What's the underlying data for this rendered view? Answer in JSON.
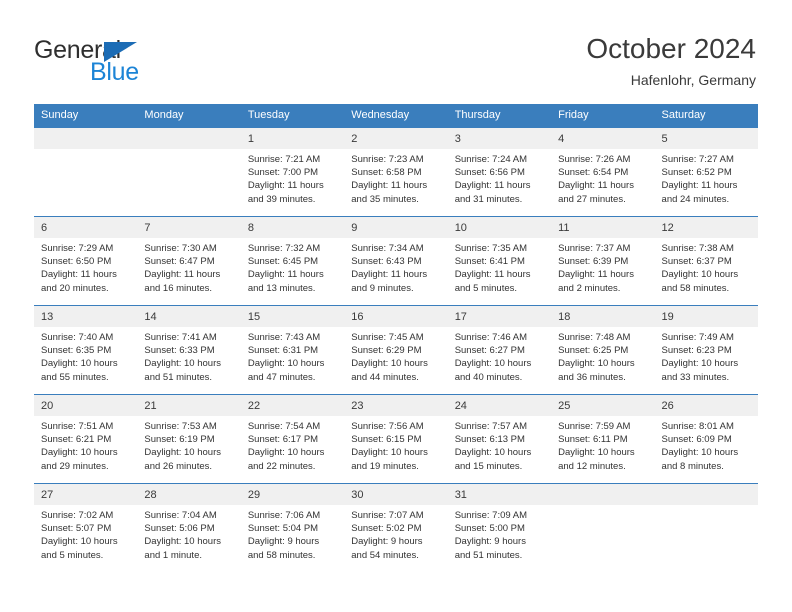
{
  "brand": {
    "name_part1": "General",
    "name_part2": "Blue",
    "triangle_icon": "triangle-icon",
    "color_dark": "#2f2f2f",
    "color_blue": "#1c84d6",
    "color_triangle": "#1c6cb5"
  },
  "header": {
    "title": "October 2024",
    "subtitle": "Hafenlohr, Germany"
  },
  "theme": {
    "header_bg": "#3a7ebd",
    "header_text": "#ffffff",
    "daynum_bg": "#f0f0f0",
    "cell_bg": "#ffffff",
    "row_border": "#3a7ebd",
    "body_text": "#333333"
  },
  "calendar": {
    "weekday_headers": [
      "Sunday",
      "Monday",
      "Tuesday",
      "Wednesday",
      "Thursday",
      "Friday",
      "Saturday"
    ],
    "weeks": [
      [
        {
          "day": "",
          "sunrise": "",
          "sunset": "",
          "daylight1": "",
          "daylight2": ""
        },
        {
          "day": "",
          "sunrise": "",
          "sunset": "",
          "daylight1": "",
          "daylight2": ""
        },
        {
          "day": "1",
          "sunrise": "Sunrise: 7:21 AM",
          "sunset": "Sunset: 7:00 PM",
          "daylight1": "Daylight: 11 hours",
          "daylight2": "and 39 minutes."
        },
        {
          "day": "2",
          "sunrise": "Sunrise: 7:23 AM",
          "sunset": "Sunset: 6:58 PM",
          "daylight1": "Daylight: 11 hours",
          "daylight2": "and 35 minutes."
        },
        {
          "day": "3",
          "sunrise": "Sunrise: 7:24 AM",
          "sunset": "Sunset: 6:56 PM",
          "daylight1": "Daylight: 11 hours",
          "daylight2": "and 31 minutes."
        },
        {
          "day": "4",
          "sunrise": "Sunrise: 7:26 AM",
          "sunset": "Sunset: 6:54 PM",
          "daylight1": "Daylight: 11 hours",
          "daylight2": "and 27 minutes."
        },
        {
          "day": "5",
          "sunrise": "Sunrise: 7:27 AM",
          "sunset": "Sunset: 6:52 PM",
          "daylight1": "Daylight: 11 hours",
          "daylight2": "and 24 minutes."
        }
      ],
      [
        {
          "day": "6",
          "sunrise": "Sunrise: 7:29 AM",
          "sunset": "Sunset: 6:50 PM",
          "daylight1": "Daylight: 11 hours",
          "daylight2": "and 20 minutes."
        },
        {
          "day": "7",
          "sunrise": "Sunrise: 7:30 AM",
          "sunset": "Sunset: 6:47 PM",
          "daylight1": "Daylight: 11 hours",
          "daylight2": "and 16 minutes."
        },
        {
          "day": "8",
          "sunrise": "Sunrise: 7:32 AM",
          "sunset": "Sunset: 6:45 PM",
          "daylight1": "Daylight: 11 hours",
          "daylight2": "and 13 minutes."
        },
        {
          "day": "9",
          "sunrise": "Sunrise: 7:34 AM",
          "sunset": "Sunset: 6:43 PM",
          "daylight1": "Daylight: 11 hours",
          "daylight2": "and 9 minutes."
        },
        {
          "day": "10",
          "sunrise": "Sunrise: 7:35 AM",
          "sunset": "Sunset: 6:41 PM",
          "daylight1": "Daylight: 11 hours",
          "daylight2": "and 5 minutes."
        },
        {
          "day": "11",
          "sunrise": "Sunrise: 7:37 AM",
          "sunset": "Sunset: 6:39 PM",
          "daylight1": "Daylight: 11 hours",
          "daylight2": "and 2 minutes."
        },
        {
          "day": "12",
          "sunrise": "Sunrise: 7:38 AM",
          "sunset": "Sunset: 6:37 PM",
          "daylight1": "Daylight: 10 hours",
          "daylight2": "and 58 minutes."
        }
      ],
      [
        {
          "day": "13",
          "sunrise": "Sunrise: 7:40 AM",
          "sunset": "Sunset: 6:35 PM",
          "daylight1": "Daylight: 10 hours",
          "daylight2": "and 55 minutes."
        },
        {
          "day": "14",
          "sunrise": "Sunrise: 7:41 AM",
          "sunset": "Sunset: 6:33 PM",
          "daylight1": "Daylight: 10 hours",
          "daylight2": "and 51 minutes."
        },
        {
          "day": "15",
          "sunrise": "Sunrise: 7:43 AM",
          "sunset": "Sunset: 6:31 PM",
          "daylight1": "Daylight: 10 hours",
          "daylight2": "and 47 minutes."
        },
        {
          "day": "16",
          "sunrise": "Sunrise: 7:45 AM",
          "sunset": "Sunset: 6:29 PM",
          "daylight1": "Daylight: 10 hours",
          "daylight2": "and 44 minutes."
        },
        {
          "day": "17",
          "sunrise": "Sunrise: 7:46 AM",
          "sunset": "Sunset: 6:27 PM",
          "daylight1": "Daylight: 10 hours",
          "daylight2": "and 40 minutes."
        },
        {
          "day": "18",
          "sunrise": "Sunrise: 7:48 AM",
          "sunset": "Sunset: 6:25 PM",
          "daylight1": "Daylight: 10 hours",
          "daylight2": "and 36 minutes."
        },
        {
          "day": "19",
          "sunrise": "Sunrise: 7:49 AM",
          "sunset": "Sunset: 6:23 PM",
          "daylight1": "Daylight: 10 hours",
          "daylight2": "and 33 minutes."
        }
      ],
      [
        {
          "day": "20",
          "sunrise": "Sunrise: 7:51 AM",
          "sunset": "Sunset: 6:21 PM",
          "daylight1": "Daylight: 10 hours",
          "daylight2": "and 29 minutes."
        },
        {
          "day": "21",
          "sunrise": "Sunrise: 7:53 AM",
          "sunset": "Sunset: 6:19 PM",
          "daylight1": "Daylight: 10 hours",
          "daylight2": "and 26 minutes."
        },
        {
          "day": "22",
          "sunrise": "Sunrise: 7:54 AM",
          "sunset": "Sunset: 6:17 PM",
          "daylight1": "Daylight: 10 hours",
          "daylight2": "and 22 minutes."
        },
        {
          "day": "23",
          "sunrise": "Sunrise: 7:56 AM",
          "sunset": "Sunset: 6:15 PM",
          "daylight1": "Daylight: 10 hours",
          "daylight2": "and 19 minutes."
        },
        {
          "day": "24",
          "sunrise": "Sunrise: 7:57 AM",
          "sunset": "Sunset: 6:13 PM",
          "daylight1": "Daylight: 10 hours",
          "daylight2": "and 15 minutes."
        },
        {
          "day": "25",
          "sunrise": "Sunrise: 7:59 AM",
          "sunset": "Sunset: 6:11 PM",
          "daylight1": "Daylight: 10 hours",
          "daylight2": "and 12 minutes."
        },
        {
          "day": "26",
          "sunrise": "Sunrise: 8:01 AM",
          "sunset": "Sunset: 6:09 PM",
          "daylight1": "Daylight: 10 hours",
          "daylight2": "and 8 minutes."
        }
      ],
      [
        {
          "day": "27",
          "sunrise": "Sunrise: 7:02 AM",
          "sunset": "Sunset: 5:07 PM",
          "daylight1": "Daylight: 10 hours",
          "daylight2": "and 5 minutes."
        },
        {
          "day": "28",
          "sunrise": "Sunrise: 7:04 AM",
          "sunset": "Sunset: 5:06 PM",
          "daylight1": "Daylight: 10 hours",
          "daylight2": "and 1 minute."
        },
        {
          "day": "29",
          "sunrise": "Sunrise: 7:06 AM",
          "sunset": "Sunset: 5:04 PM",
          "daylight1": "Daylight: 9 hours",
          "daylight2": "and 58 minutes."
        },
        {
          "day": "30",
          "sunrise": "Sunrise: 7:07 AM",
          "sunset": "Sunset: 5:02 PM",
          "daylight1": "Daylight: 9 hours",
          "daylight2": "and 54 minutes."
        },
        {
          "day": "31",
          "sunrise": "Sunrise: 7:09 AM",
          "sunset": "Sunset: 5:00 PM",
          "daylight1": "Daylight: 9 hours",
          "daylight2": "and 51 minutes."
        },
        {
          "day": "",
          "sunrise": "",
          "sunset": "",
          "daylight1": "",
          "daylight2": ""
        },
        {
          "day": "",
          "sunrise": "",
          "sunset": "",
          "daylight1": "",
          "daylight2": ""
        }
      ]
    ]
  }
}
